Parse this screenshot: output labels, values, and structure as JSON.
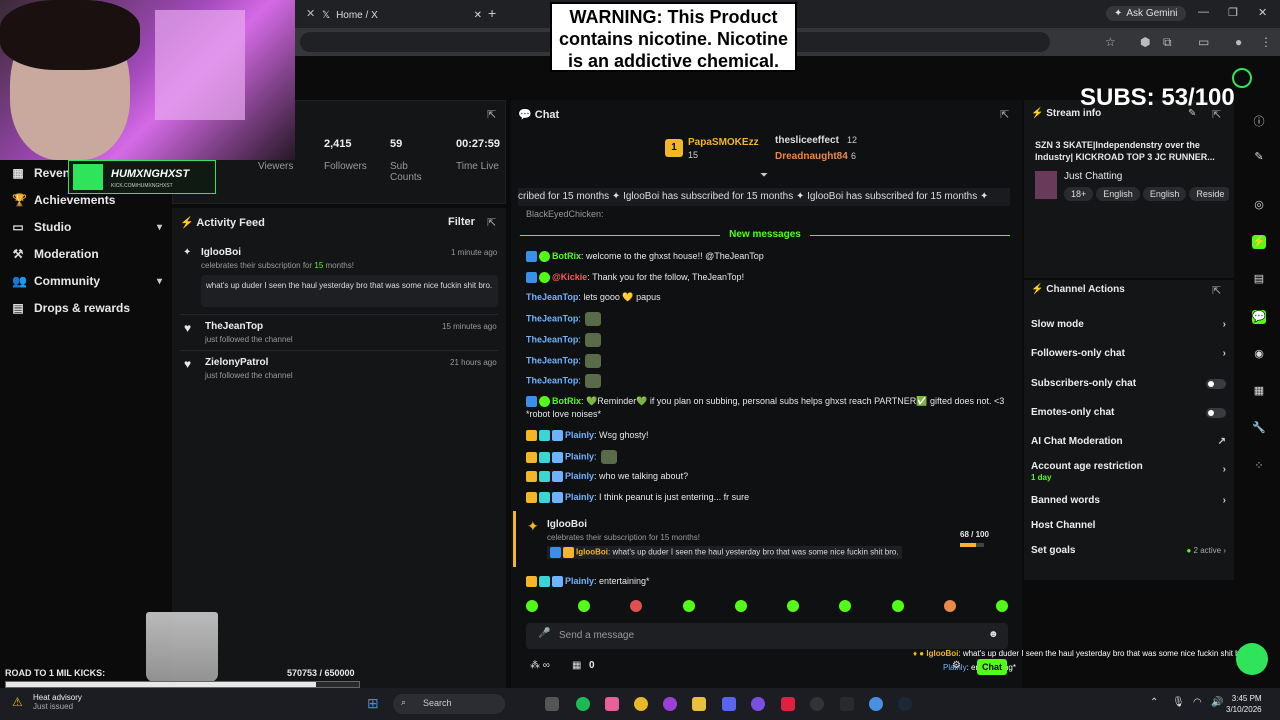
{
  "browser": {
    "tab_title": "Home / X",
    "gemini_label": "Ask Gemini"
  },
  "warning": {
    "text": "WARNING: This Product contains nicotine. Nicotine is an addictive chemical."
  },
  "webcam_badge": {
    "name": "HUMXNGHXST",
    "sub": "KICK.COM/HUMXNGHXST"
  },
  "overlay": {
    "subs": "SUBS: 53/100"
  },
  "sidebar": {
    "items": [
      {
        "label": "Revenue",
        "icon": "dollar-icon"
      },
      {
        "label": "Achievements",
        "icon": "trophy-icon"
      },
      {
        "label": "Studio",
        "icon": "monitor-icon"
      },
      {
        "label": "Moderation",
        "icon": "hammer-icon"
      },
      {
        "label": "Community",
        "icon": "users-icon"
      },
      {
        "label": "Drops & rewards",
        "icon": "gift-icon"
      }
    ]
  },
  "stats": {
    "viewers_label": "Viewers",
    "followers_value": "2,415",
    "followers_label": "Followers",
    "subs_value": "59",
    "subs_label": "Sub Counts",
    "time_value": "00:27:59",
    "time_label": "Time Live"
  },
  "activity": {
    "title": "Activity Feed",
    "filter": "Filter",
    "items": [
      {
        "name": "IglooBoi",
        "sub_pre": "celebrates their subscription for ",
        "sub_num": "15",
        "sub_post": " months!",
        "time": "1 minute ago",
        "quote": "what's up duder I seen the haul yesterday bro that was some nice fuckin shit bro."
      },
      {
        "name": "TheJeanTop",
        "sub": "just followed the channel",
        "time": "15 minutes ago"
      },
      {
        "name": "ZielonyPatrol",
        "sub": "just followed the channel",
        "time": "21 hours ago"
      }
    ]
  },
  "chat": {
    "title": "Chat",
    "gifters": [
      {
        "rank": "1",
        "name": "PapaSMOKEzz",
        "count": "15"
      },
      {
        "name": "thesliceeffect",
        "count": "12"
      },
      {
        "name": "Dreadnaught84",
        "count": "6"
      }
    ],
    "ticker": "cribed for 15 months ✦ IglooBoi has subscribed for 15 months ✦ IglooBoi has subscribed for 15 months ✦",
    "ticker_partial": "BlackEyedChicken:",
    "new_messages": "New messages",
    "messages": [
      {
        "user": "BotRix",
        "color": "#53fc18",
        "text": ": welcome to the ghxst house!! @TheJeanTop"
      },
      {
        "user": "@Kickie",
        "color": "#ff5a5a",
        "text": ": Thank you for the follow, TheJeanTop!"
      },
      {
        "user": "TheJeanTop",
        "color": "#6fb3ff",
        "text": ": lets gooo 💛 papus"
      },
      {
        "user": "TheJeanTop",
        "color": "#6fb3ff",
        "text": ":"
      },
      {
        "user": "TheJeanTop",
        "color": "#6fb3ff",
        "text": ":"
      },
      {
        "user": "TheJeanTop",
        "color": "#6fb3ff",
        "text": ":"
      },
      {
        "user": "TheJeanTop",
        "color": "#6fb3ff",
        "text": ":"
      },
      {
        "user": "BotRix",
        "color": "#53fc18",
        "text": ": 💚Reminder💚 if you plan on subbing, personal subs helps ghxst reach PARTNER✅ gifted does not. <3 *robot love noises*"
      },
      {
        "user": "Plainly",
        "color": "#6fb3ff",
        "text": ": Wsg ghosty!"
      },
      {
        "user": "Plainly",
        "color": "#6fb3ff",
        "text": ":"
      },
      {
        "user": "Plainly",
        "color": "#6fb3ff",
        "text": ": who we talking about?"
      },
      {
        "user": "Plainly",
        "color": "#6fb3ff",
        "text": ": I think peanut is just entering... fr sure"
      }
    ],
    "sub_card": {
      "user": "IglooBoi",
      "line": "celebrates their subscription for 15 months!",
      "quote_user": "IglooBoi",
      "quote": ": what's up duder I seen the haul yesterday bro that was some nice fuckin shit bro.",
      "progress_text": "68 / 100",
      "progress_fraction": 0.68
    },
    "last_msg": {
      "user": "Plainly",
      "text": ": entertaining*"
    },
    "input_placeholder": "Send a message",
    "points": "0",
    "chat_button": "Chat"
  },
  "stream_info": {
    "title": "Stream info",
    "stream_title": "SZN 3 SKATE|Independenstry over the Industry| KICKROAD TOP 3 JC RUNNER...",
    "category": "Just Chatting",
    "tags": [
      "18+",
      "English",
      "English",
      "Reside"
    ]
  },
  "channel_actions": {
    "title": "Channel Actions",
    "items": [
      {
        "label": "Slow mode",
        "type": "chevron"
      },
      {
        "label": "Followers-only chat",
        "type": "chevron"
      },
      {
        "label": "Subscribers-only chat",
        "type": "toggle"
      },
      {
        "label": "Emotes-only chat",
        "type": "toggle"
      },
      {
        "label": "AI Chat Moderation",
        "type": "link"
      },
      {
        "label": "Account age restriction",
        "type": "chevron",
        "sub": "1 day"
      },
      {
        "label": "Banned words",
        "type": "chevron"
      },
      {
        "label": "Host Channel",
        "type": "none"
      },
      {
        "label": "Set goals",
        "type": "chevron",
        "status": "2 active"
      }
    ]
  },
  "road": {
    "label": "ROAD TO 1 MIL KICKS:",
    "count": "570753 / 650000",
    "fraction": 0.878
  },
  "overlay_chat": {
    "user": "IglooBoi",
    "text": ": what's up duder I seen the haul yesterday bro that was some nice fuckin shit bro.",
    "user2": "Plainly",
    "text2": ": entertaining*",
    "button": "Chat"
  },
  "taskbar": {
    "weather_title": "Heat advisory",
    "weather_sub": "Just issued",
    "search": "Search",
    "time": "3:45 PM",
    "date": "3/10/2026"
  },
  "colors": {
    "kick_green": "#53fc18",
    "gold": "#f2b628",
    "panel": "#141517"
  }
}
